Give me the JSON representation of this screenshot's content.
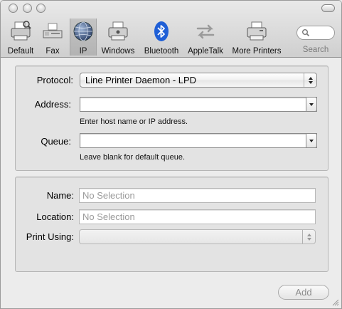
{
  "toolbar": {
    "items": [
      {
        "label": "Default",
        "icon": "default-printer-icon"
      },
      {
        "label": "Fax",
        "icon": "fax-icon"
      },
      {
        "label": "IP",
        "icon": "ip-globe-icon",
        "selected": true
      },
      {
        "label": "Windows",
        "icon": "windows-printer-icon"
      },
      {
        "label": "Bluetooth",
        "icon": "bluetooth-icon"
      },
      {
        "label": "AppleTalk",
        "icon": "appletalk-icon"
      },
      {
        "label": "More Printers",
        "icon": "more-printers-icon"
      }
    ],
    "search_label": "Search"
  },
  "connection": {
    "protocol_label": "Protocol:",
    "protocol_value": "Line Printer Daemon - LPD",
    "address_label": "Address:",
    "address_value": "",
    "address_hint": "Enter host name or IP address.",
    "queue_label": "Queue:",
    "queue_value": "",
    "queue_hint": "Leave blank for default queue."
  },
  "details": {
    "name_label": "Name:",
    "name_placeholder": "No Selection",
    "location_label": "Location:",
    "location_placeholder": "No Selection",
    "print_using_label": "Print Using:",
    "print_using_value": ""
  },
  "actions": {
    "add_label": "Add"
  },
  "colors": {
    "bluetooth": "#1f5fd6",
    "window_bg": "#ececec"
  }
}
